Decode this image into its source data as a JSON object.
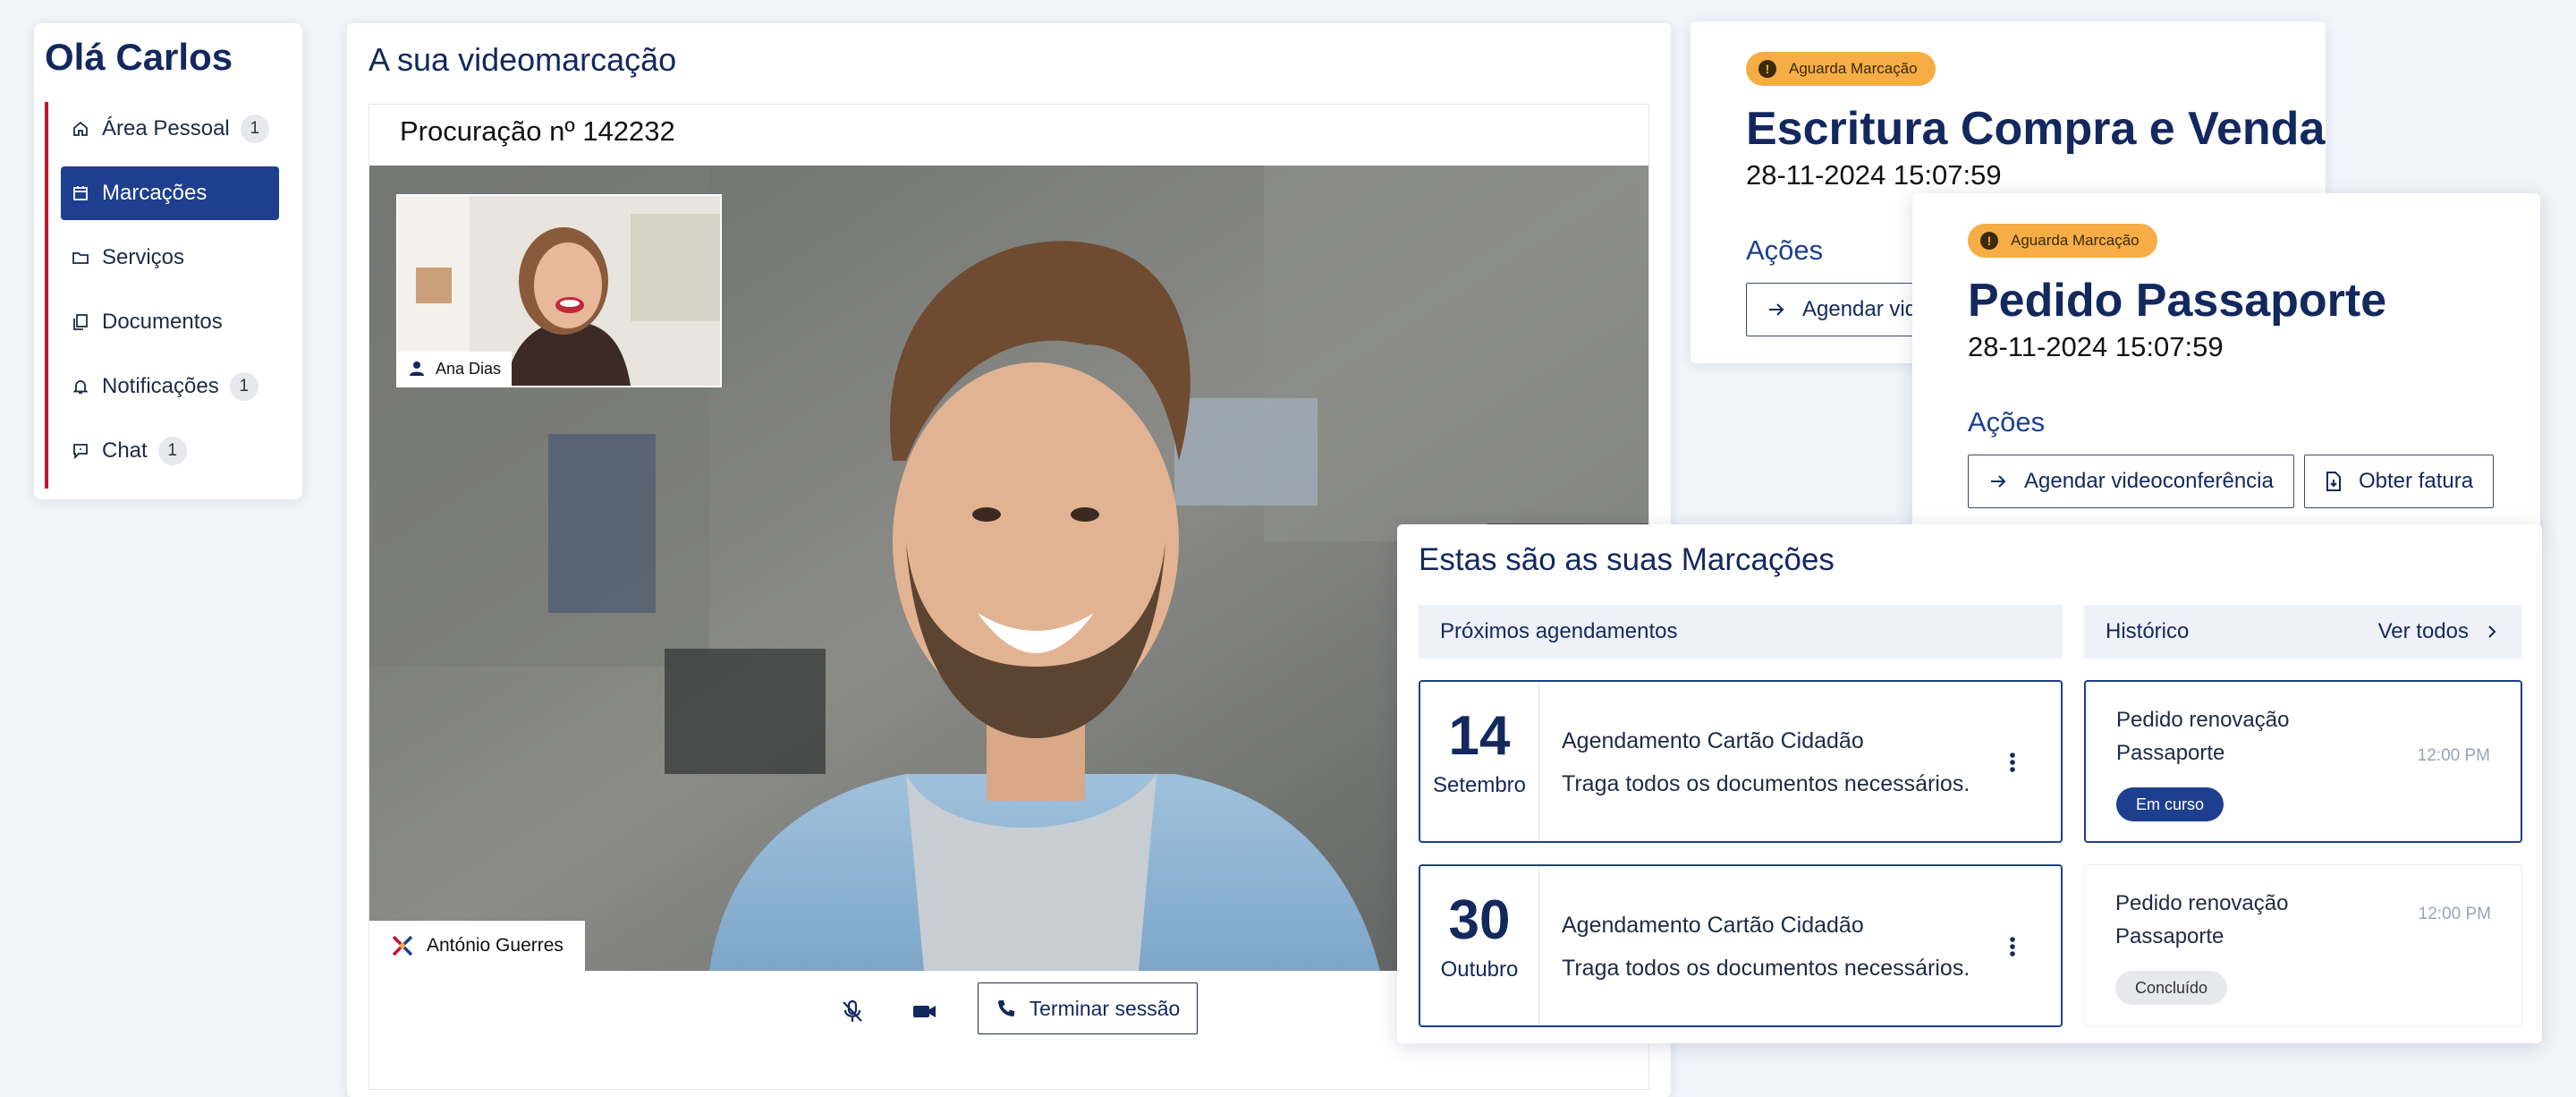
{
  "sidebar": {
    "greeting": "Olá Carlos",
    "items": [
      {
        "label": "Área Pessoal",
        "badge": "1",
        "icon": "home-icon"
      },
      {
        "label": "Marcações",
        "badge": "",
        "icon": "calendar-icon"
      },
      {
        "label": "Serviços",
        "badge": "",
        "icon": "folder-icon"
      },
      {
        "label": "Documentos",
        "badge": "",
        "icon": "documents-icon"
      },
      {
        "label": "Notificações",
        "badge": "1",
        "icon": "bell-icon"
      },
      {
        "label": "Chat",
        "badge": "1",
        "icon": "chat-icon"
      }
    ],
    "active": "Marcações"
  },
  "video": {
    "heading": "A sua videomarcação",
    "title": "Procuração nº 142232",
    "pip_name": "Ana Dias",
    "main_name": "António Guerres",
    "end_label": "Terminar sessão"
  },
  "booking1": {
    "status": "Aguarda Marcação",
    "title": "Escritura Compra e Venda",
    "datetime": "28-11-2024 15:07:59",
    "actions_label": "Ações",
    "schedule_label": "Agendar videoconferência"
  },
  "booking2": {
    "status": "Aguarda Marcação",
    "title": "Pedido Passaporte",
    "datetime": "28-11-2024 15:07:59",
    "actions_label": "Ações",
    "schedule_label": "Agendar videoconferência",
    "invoice_label": "Obter fatura"
  },
  "appointments": {
    "title": "Estas são as suas Marcações",
    "upcoming_label": "Próximos agendamentos",
    "history_label": "Histórico",
    "see_all_label": "Ver todos",
    "upcoming": [
      {
        "day": "14",
        "month": "Setembro",
        "title": "Agendamento Cartão Cidadão",
        "subtitle": "Traga todos os documentos necessários."
      },
      {
        "day": "30",
        "month": "Outubro",
        "title": "Agendamento Cartão Cidadão",
        "subtitle": "Traga todos os documentos necessários."
      }
    ],
    "history": [
      {
        "title": "Pedido renovação Passaporte",
        "time": "12:00 PM",
        "status": "Em curso"
      },
      {
        "title": "Pedido renovação Passaporte",
        "time": "12:00 PM",
        "status": "Concluído"
      }
    ]
  },
  "colors": {
    "navy": "#13285e",
    "primary": "#1e3f8f",
    "accent_red": "#c8102e",
    "status_orange": "#f6ad45"
  }
}
